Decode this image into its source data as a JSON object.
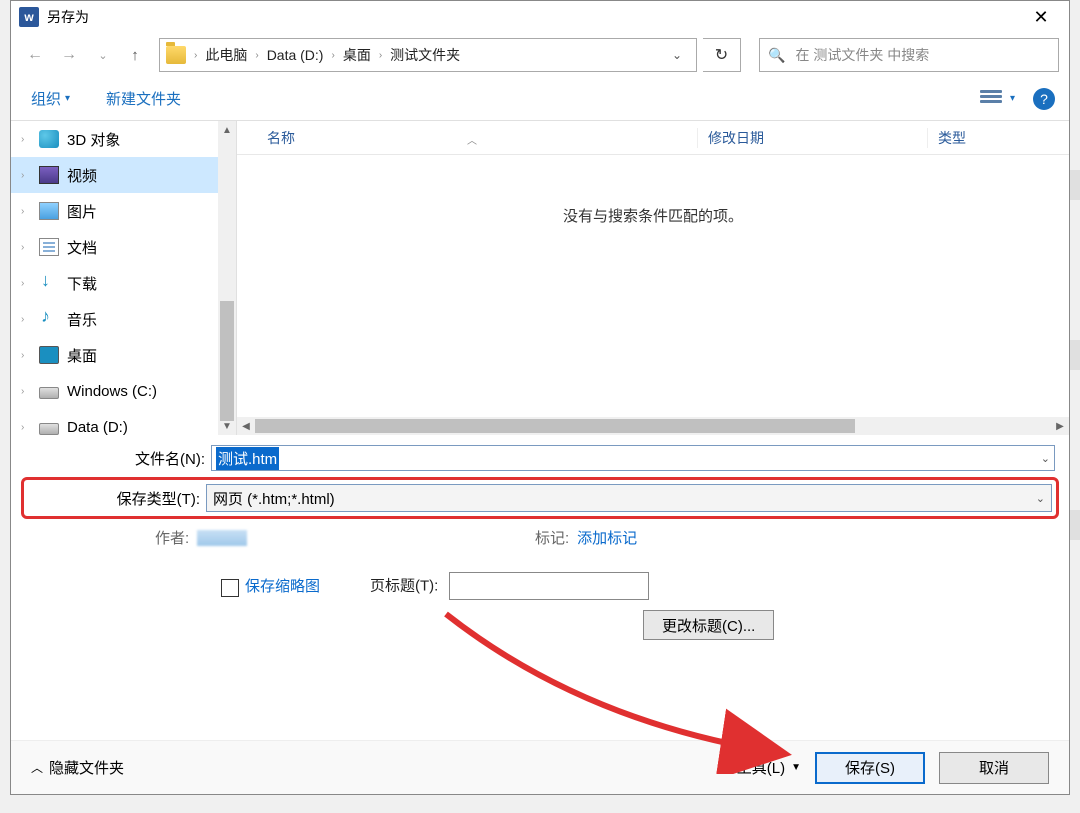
{
  "window": {
    "title": "另存为",
    "close": "✕"
  },
  "nav": {
    "back": "←",
    "forward": "→",
    "recent_dd": "⌄",
    "up": "↑",
    "breadcrumbs": [
      "此电脑",
      "Data (D:)",
      "桌面",
      "测试文件夹"
    ],
    "refresh": "↻",
    "search_placeholder": "在 测试文件夹 中搜索"
  },
  "toolbar": {
    "organize": "组织",
    "new_folder": "新建文件夹",
    "help": "?"
  },
  "tree": {
    "items": [
      {
        "label": "3D 对象",
        "icon": "ico-3d"
      },
      {
        "label": "视频",
        "icon": "ico-video",
        "selected": true
      },
      {
        "label": "图片",
        "icon": "ico-pic"
      },
      {
        "label": "文档",
        "icon": "ico-doc"
      },
      {
        "label": "下载",
        "icon": "ico-dl"
      },
      {
        "label": "音乐",
        "icon": "ico-music"
      },
      {
        "label": "桌面",
        "icon": "ico-desktop"
      },
      {
        "label": "Windows (C:)",
        "icon": "ico-drive"
      },
      {
        "label": "Data (D:)",
        "icon": "ico-drive"
      }
    ]
  },
  "files": {
    "col_name": "名称",
    "col_date": "修改日期",
    "col_type": "类型",
    "empty": "没有与搜索条件匹配的项。"
  },
  "form": {
    "fname_label": "文件名(N):",
    "fname_value": "测试.htm",
    "ftype_label": "保存类型(T):",
    "ftype_value": "网页 (*.htm;*.html)",
    "author_label": "作者:",
    "tag_label": "标记:",
    "tag_link": "添加标记",
    "thumb_check": "保存缩略图",
    "ptitle_label": "页标题(T):",
    "change_title_btn": "更改标题(C)..."
  },
  "footer": {
    "hide_folders": "隐藏文件夹",
    "tools": "工具(L)",
    "save": "保存(S)",
    "cancel": "取消"
  }
}
